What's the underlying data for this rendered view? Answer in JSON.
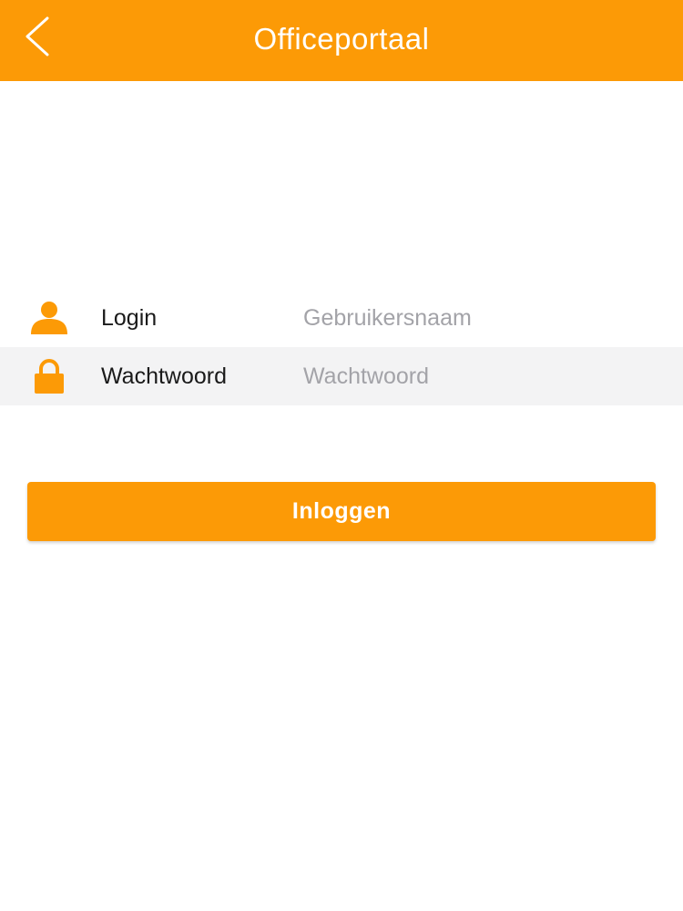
{
  "nav": {
    "title": "Officeportaal",
    "back_icon": "chevron-left-icon"
  },
  "form": {
    "login": {
      "icon": "user-icon",
      "label": "Login",
      "placeholder": "Gebruikersnaam",
      "value": ""
    },
    "password": {
      "icon": "lock-icon",
      "label": "Wachtwoord",
      "placeholder": "Wachtwoord",
      "value": ""
    }
  },
  "login_button": {
    "label": "Inloggen"
  },
  "colors": {
    "accent": "#fc9a06",
    "row_alt_background": "#f3f3f4",
    "placeholder": "#a3a3a8"
  }
}
